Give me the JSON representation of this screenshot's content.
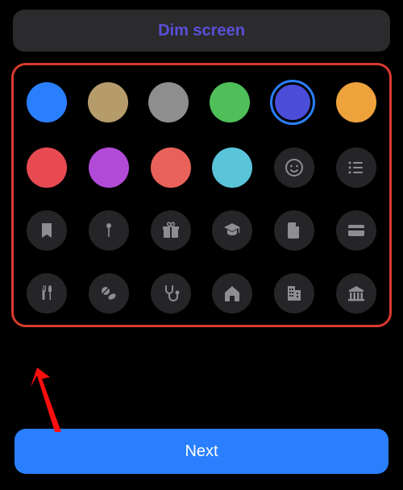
{
  "dim_button_label": "Dim screen",
  "colors": {
    "row1": [
      {
        "name": "blue",
        "hex": "#2a7fff",
        "selected": false
      },
      {
        "name": "tan",
        "hex": "#b59c6a",
        "selected": false
      },
      {
        "name": "gray",
        "hex": "#8e8e8e",
        "selected": false
      },
      {
        "name": "green",
        "hex": "#4fbf5a",
        "selected": false
      },
      {
        "name": "indigo",
        "hex": "#4a4dd8",
        "selected": true
      },
      {
        "name": "orange",
        "hex": "#eea23b",
        "selected": false
      }
    ],
    "row2": [
      {
        "name": "red",
        "hex": "#e84a52",
        "selected": false
      },
      {
        "name": "purple",
        "hex": "#b24ad8",
        "selected": false
      },
      {
        "name": "coral",
        "hex": "#e8625a",
        "selected": false
      },
      {
        "name": "cyan",
        "hex": "#5ac4d8",
        "selected": false
      }
    ]
  },
  "icons": {
    "row2_extra": [
      "smiley-icon",
      "list-icon"
    ],
    "row3": [
      "bookmark-icon",
      "pin-icon",
      "gift-icon",
      "graduation-icon",
      "document-icon",
      "card-icon"
    ],
    "row4": [
      "utensils-icon",
      "pills-icon",
      "stethoscope-icon",
      "house-icon",
      "building-icon",
      "bank-icon"
    ]
  },
  "next_button_label": "Next",
  "annotation_arrow_color": "#ff0e0e"
}
